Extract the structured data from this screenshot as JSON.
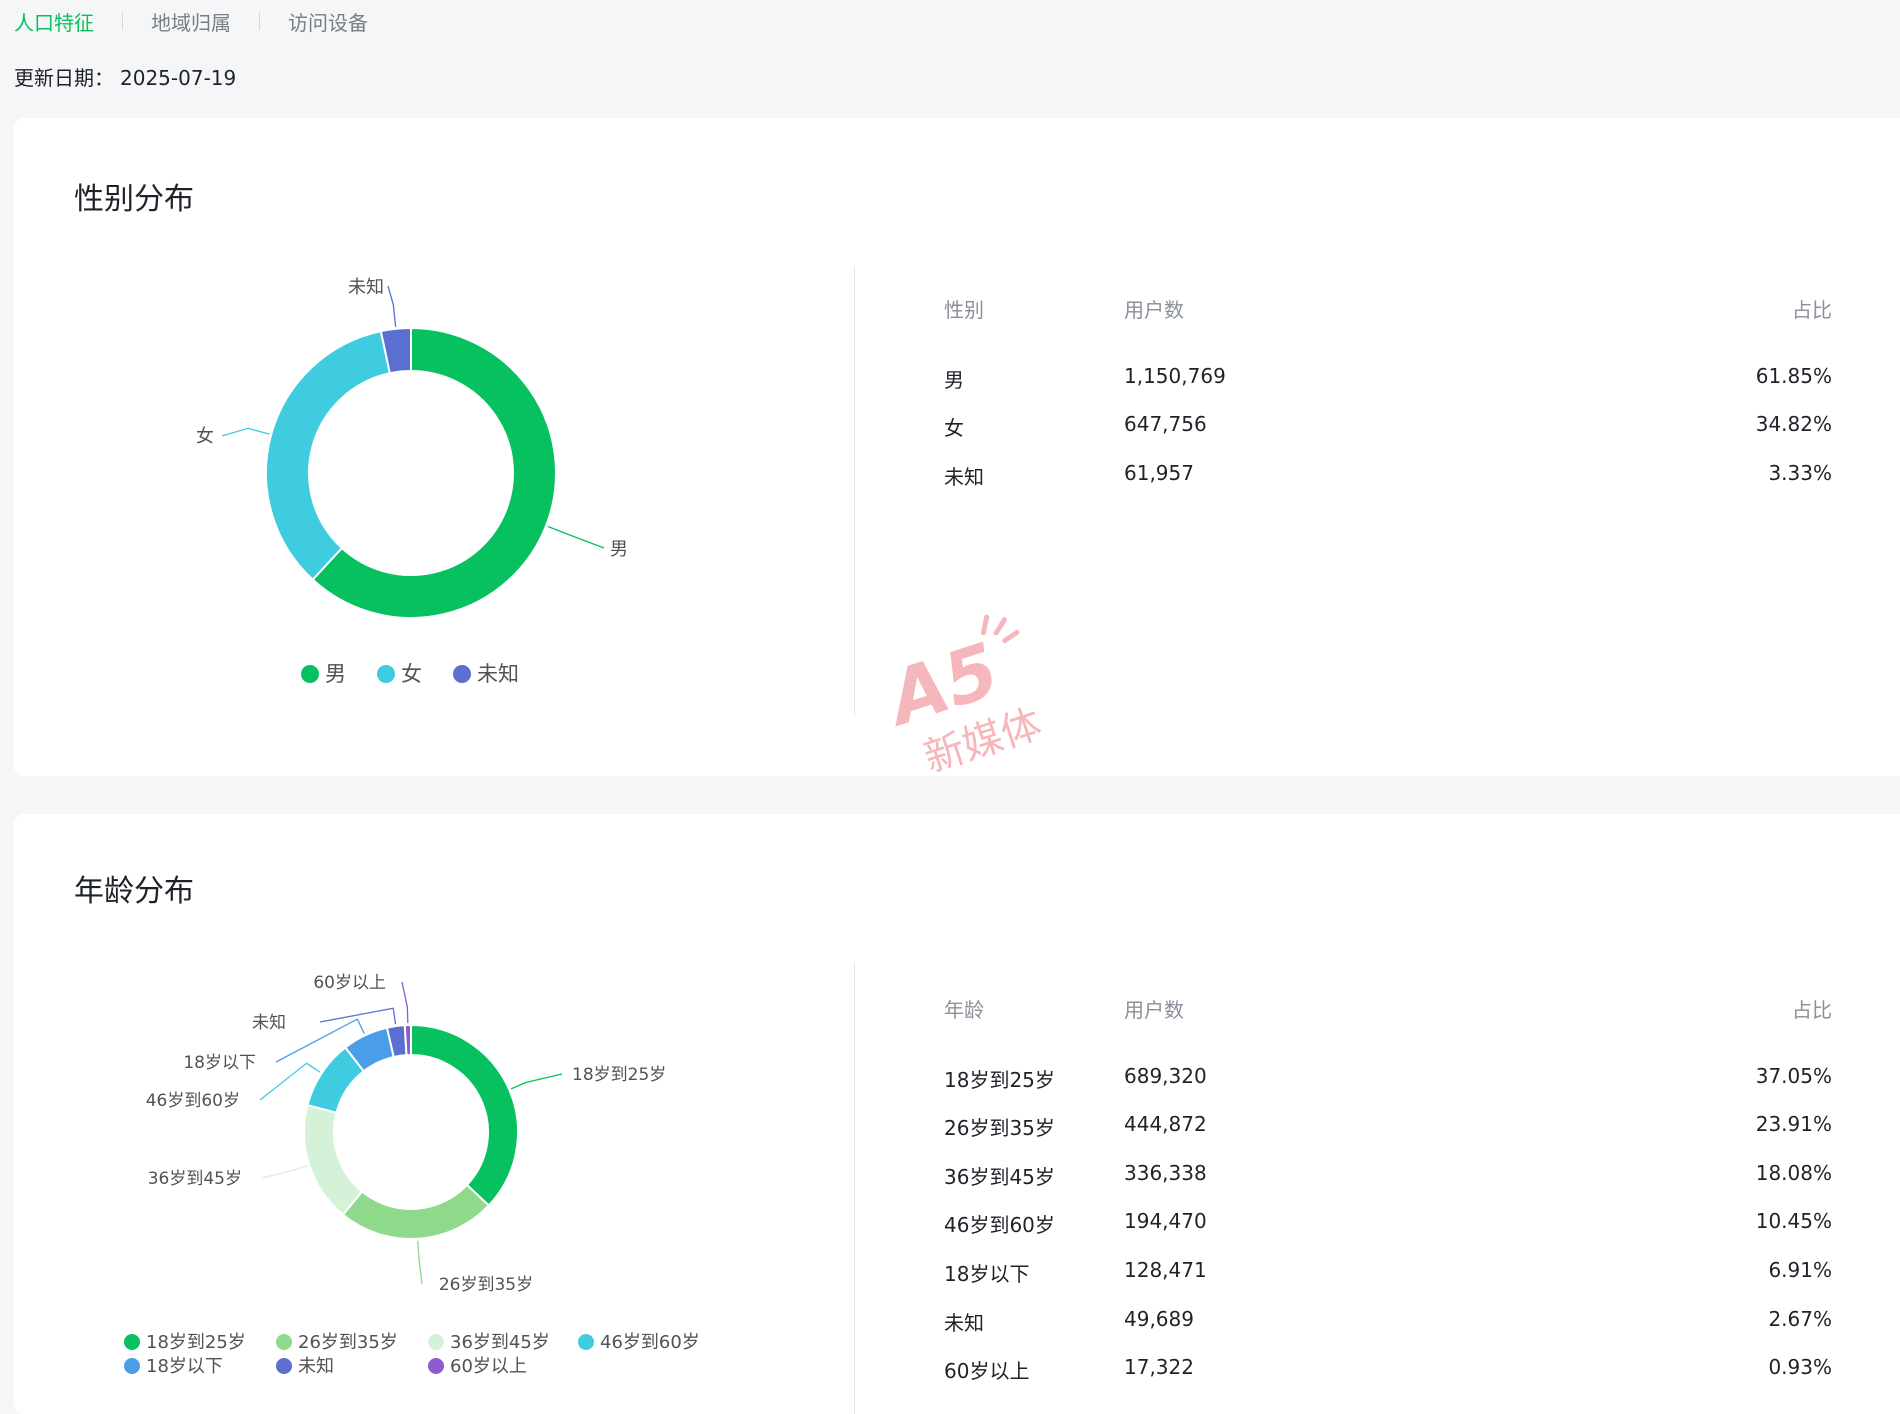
{
  "tabs": [
    "人口特征",
    "地域归属",
    "访问设备"
  ],
  "active_tab": 0,
  "update": {
    "label": "更新日期：",
    "date": "2025-07-19"
  },
  "gender": {
    "title": "性别分布",
    "table_headers": [
      "性别",
      "用户数",
      "占比"
    ],
    "rows": [
      {
        "label": "男",
        "users": "1,150,769",
        "pct": "61.85%"
      },
      {
        "label": "女",
        "users": "647,756",
        "pct": "34.82%"
      },
      {
        "label": "未知",
        "users": "61,957",
        "pct": "3.33%"
      }
    ],
    "legend": [
      "男",
      "女",
      "未知"
    ]
  },
  "age": {
    "title": "年龄分布",
    "table_headers": [
      "年龄",
      "用户数",
      "占比"
    ],
    "rows": [
      {
        "label": "18岁到25岁",
        "users": "689,320",
        "pct": "37.05%"
      },
      {
        "label": "26岁到35岁",
        "users": "444,872",
        "pct": "23.91%"
      },
      {
        "label": "36岁到45岁",
        "users": "336,338",
        "pct": "18.08%"
      },
      {
        "label": "46岁到60岁",
        "users": "194,470",
        "pct": "10.45%"
      },
      {
        "label": "18岁以下",
        "users": "128,471",
        "pct": "6.91%"
      },
      {
        "label": "未知",
        "users": "49,689",
        "pct": "2.67%"
      },
      {
        "label": "60岁以上",
        "users": "17,322",
        "pct": "0.93%"
      }
    ],
    "legend": [
      "18岁到25岁",
      "26岁到35岁",
      "36岁到45岁",
      "46岁到60岁",
      "18岁以下",
      "未知",
      "60岁以上"
    ]
  },
  "chart_data": [
    {
      "type": "pie",
      "title": "性别分布",
      "categories": [
        "男",
        "女",
        "未知"
      ],
      "values": [
        61.85,
        34.82,
        3.33
      ],
      "colors": [
        "#07c160",
        "#3fcbe0",
        "#5b6fd0"
      ],
      "legend_position": "bottom"
    },
    {
      "type": "pie",
      "title": "年龄分布",
      "categories": [
        "18岁到25岁",
        "26岁到35岁",
        "36岁到45岁",
        "46岁到60岁",
        "18岁以下",
        "未知",
        "60岁以上"
      ],
      "values": [
        37.05,
        23.91,
        18.08,
        10.45,
        6.91,
        2.67,
        0.93
      ],
      "colors": [
        "#07c160",
        "#8ed98b",
        "#d5f2d8",
        "#3fcbe0",
        "#4a9ee8",
        "#5b6fd0",
        "#8e5bd0"
      ],
      "legend_position": "bottom"
    }
  ],
  "watermark": {
    "brand": "A5",
    "sub": "新媒体"
  }
}
